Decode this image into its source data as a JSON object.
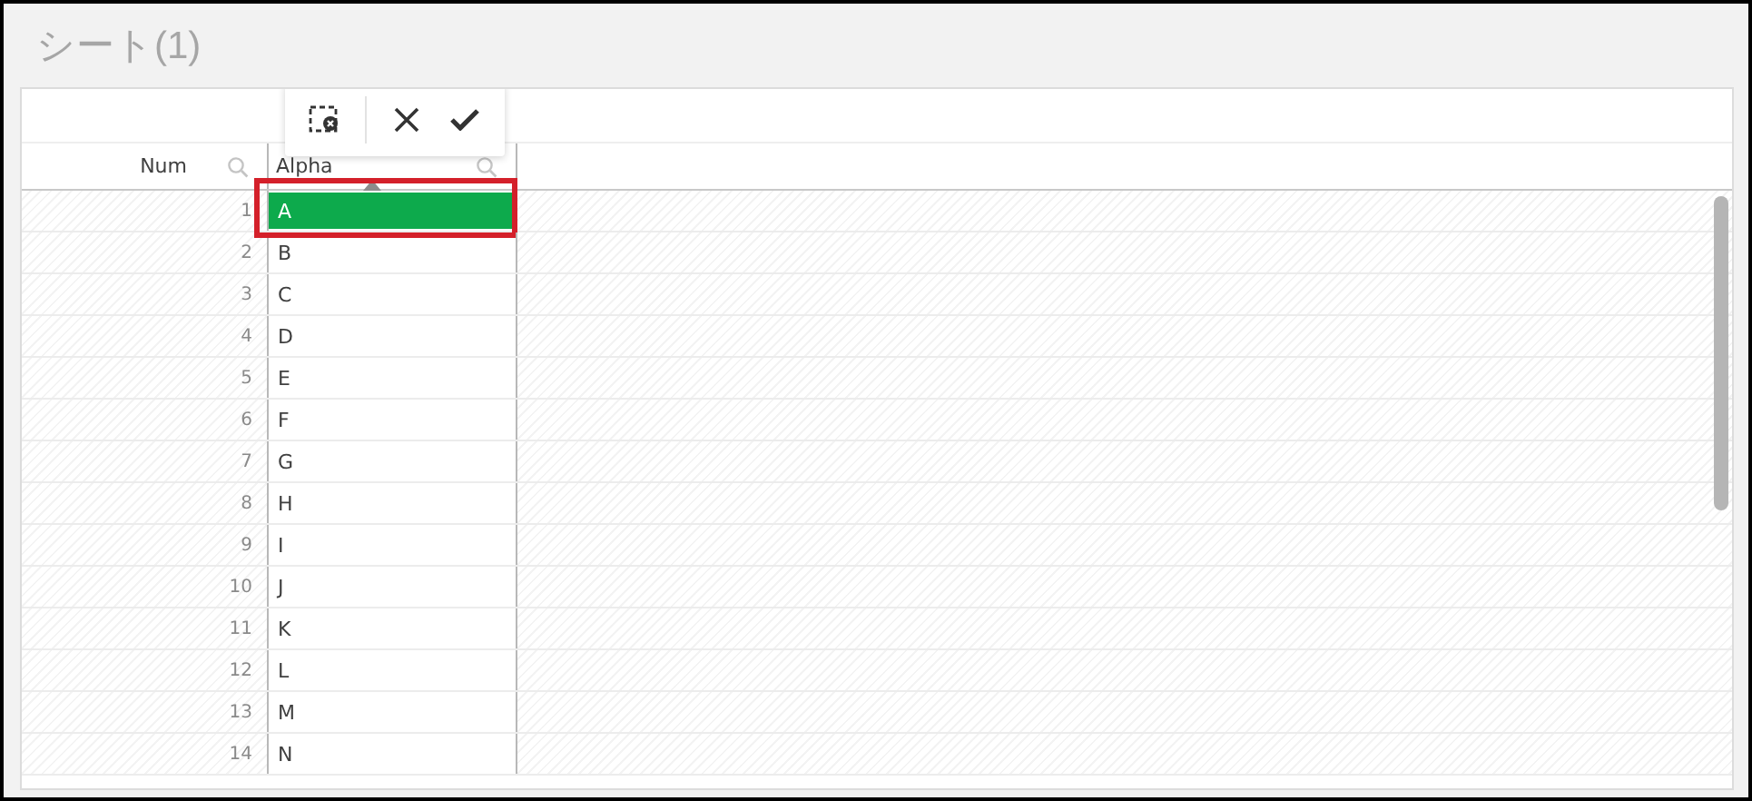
{
  "title": "シート(1)",
  "toolbar": {
    "buttons": [
      {
        "kind": "clear-selection"
      },
      {
        "kind": "cancel"
      },
      {
        "kind": "confirm"
      }
    ]
  },
  "columns": [
    {
      "label": "Num",
      "sorted": false
    },
    {
      "label": "Alpha",
      "sorted": true
    }
  ],
  "rows": [
    {
      "num": "1",
      "alpha": "A",
      "selected": true,
      "outlined": true
    },
    {
      "num": "2",
      "alpha": "B",
      "selected": false,
      "outlined": false
    },
    {
      "num": "3",
      "alpha": "C",
      "selected": false,
      "outlined": false
    },
    {
      "num": "4",
      "alpha": "D",
      "selected": false,
      "outlined": false
    },
    {
      "num": "5",
      "alpha": "E",
      "selected": false,
      "outlined": false
    },
    {
      "num": "6",
      "alpha": "F",
      "selected": false,
      "outlined": false
    },
    {
      "num": "7",
      "alpha": "G",
      "selected": false,
      "outlined": false
    },
    {
      "num": "8",
      "alpha": "H",
      "selected": false,
      "outlined": false
    },
    {
      "num": "9",
      "alpha": "I",
      "selected": false,
      "outlined": false
    },
    {
      "num": "10",
      "alpha": "J",
      "selected": false,
      "outlined": false
    },
    {
      "num": "11",
      "alpha": "K",
      "selected": false,
      "outlined": false
    },
    {
      "num": "12",
      "alpha": "L",
      "selected": false,
      "outlined": false
    },
    {
      "num": "13",
      "alpha": "M",
      "selected": false,
      "outlined": false
    },
    {
      "num": "14",
      "alpha": "N",
      "selected": false,
      "outlined": false
    }
  ]
}
